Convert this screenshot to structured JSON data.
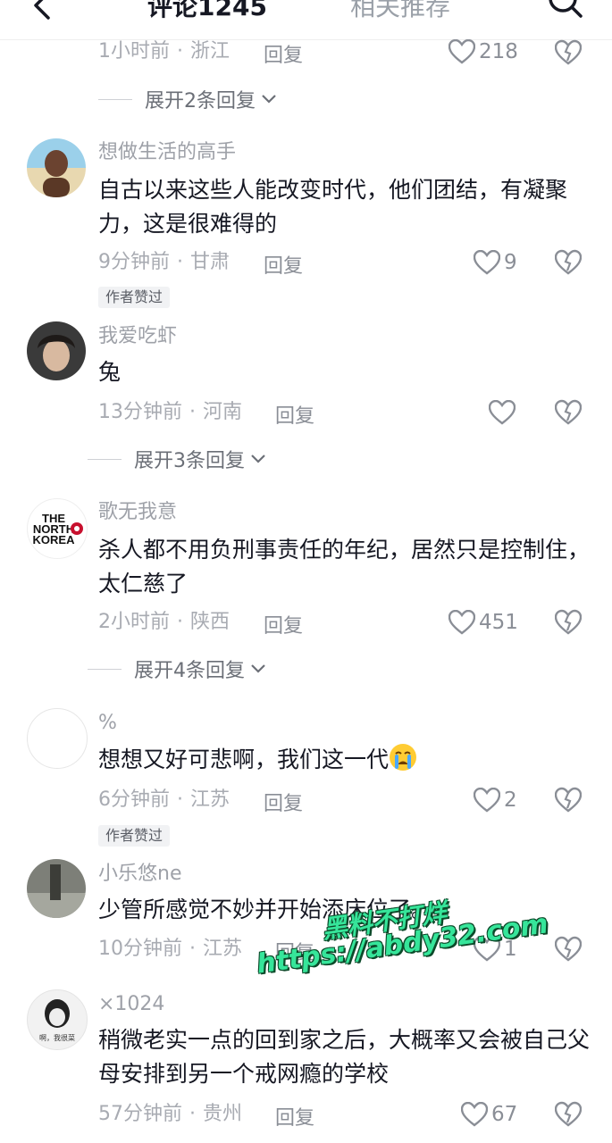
{
  "header": {
    "tab_comments": "评论1245",
    "tab_related": "相关推荐"
  },
  "top_item": {
    "time": "1小时前",
    "location": "浙江",
    "reply": "回复",
    "likes": "218",
    "expand": "展开2条回复"
  },
  "comments": [
    {
      "username": "想做生活的高手",
      "content": "自古以来这些人能改变时代，他们团结，有凝聚力，这是很难得的",
      "time": "9分钟前",
      "location": "甘肃",
      "reply": "回复",
      "likes": "9",
      "badge": "作者赞过"
    },
    {
      "username": "我爱吃虾",
      "content": "兔",
      "time": "13分钟前",
      "location": "河南",
      "reply": "回复",
      "likes": "",
      "expand": "展开3条回复"
    },
    {
      "username": "歌无我意",
      "avatar_text_1": "THE",
      "avatar_text_2": "NORTH",
      "avatar_text_3": "KOREA",
      "content": "杀人都不用负刑事责任的年纪，居然只是控制住，太仁慈了",
      "time": "2小时前",
      "location": "陕西",
      "reply": "回复",
      "likes": "451",
      "expand": "展开4条回复"
    },
    {
      "username": "%",
      "content": "想想又好可悲啊，我们这一代",
      "time": "6分钟前",
      "location": "江苏",
      "reply": "回复",
      "likes": "2",
      "badge": "作者赞过"
    },
    {
      "username": "小乐悠ne",
      "content": "少管所感觉不妙并开始添床位了。",
      "time": "10分钟前",
      "location": "江苏",
      "reply": "回复",
      "likes": "1"
    },
    {
      "username": "×1024",
      "avatar_text": "啊，我很菜",
      "content": "稍微老实一点的回到家之后，大概率又会被自己父母安排到另一个戒网瘾的学校",
      "time": "57分钟前",
      "location": "贵州",
      "reply": "回复",
      "likes": "67"
    }
  ],
  "watermark": {
    "line1": "黑料不打烊",
    "line2": "https://abdy32.com"
  },
  "colors": {
    "text": "#161823",
    "meta": "#a8abb2",
    "watermark": "#36e59a"
  }
}
